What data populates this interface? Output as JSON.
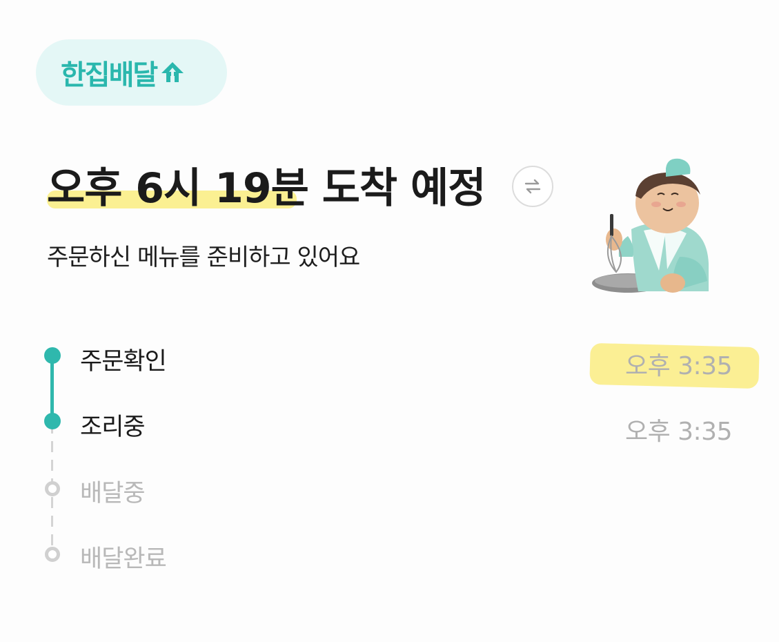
{
  "brand": {
    "badge_label": "한집배달",
    "badge_icon": "house-arrow-up-icon",
    "accent_color": "#2ab7ad",
    "badge_bg_color": "#e4f7f6"
  },
  "eta": {
    "headline": "오후 6시 19분 도착 예정",
    "switch_icon": "swap-arrows-icon",
    "status_message": "주문하신 메뉴를 준비하고 있어요",
    "highlight_color": "#fbee86"
  },
  "illustration": {
    "name": "chef-character-illustration"
  },
  "timeline": {
    "steps": [
      {
        "label": "주문확인",
        "time": "오후 3:35",
        "state": "done"
      },
      {
        "label": "조리중",
        "time": "오후 3:35",
        "state": "current"
      },
      {
        "label": "배달중",
        "time": "",
        "state": "pending"
      },
      {
        "label": "배달완료",
        "time": "",
        "state": "pending"
      }
    ]
  }
}
